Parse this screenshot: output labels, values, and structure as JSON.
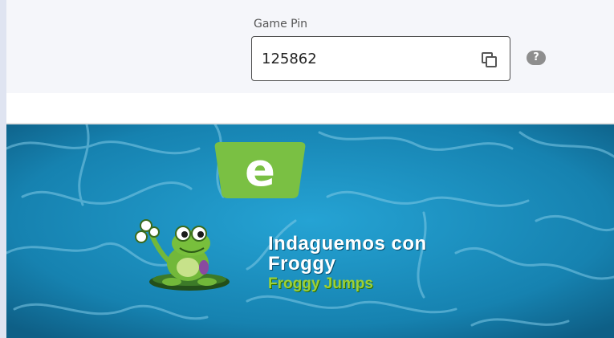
{
  "game_pin": {
    "label": "Game Pin",
    "value": "125862",
    "copy_icon": "copy-icon",
    "help_icon": "help-icon",
    "help_glyph": "?"
  },
  "banner": {
    "logo_letter": "e",
    "title_line1": "Indaguemos con",
    "title_line2": "Froggy",
    "subtitle": "Froggy Jumps",
    "logo_color": "#7ac043",
    "water_color": "#1a87b5",
    "subtitle_color": "#9dd137"
  }
}
